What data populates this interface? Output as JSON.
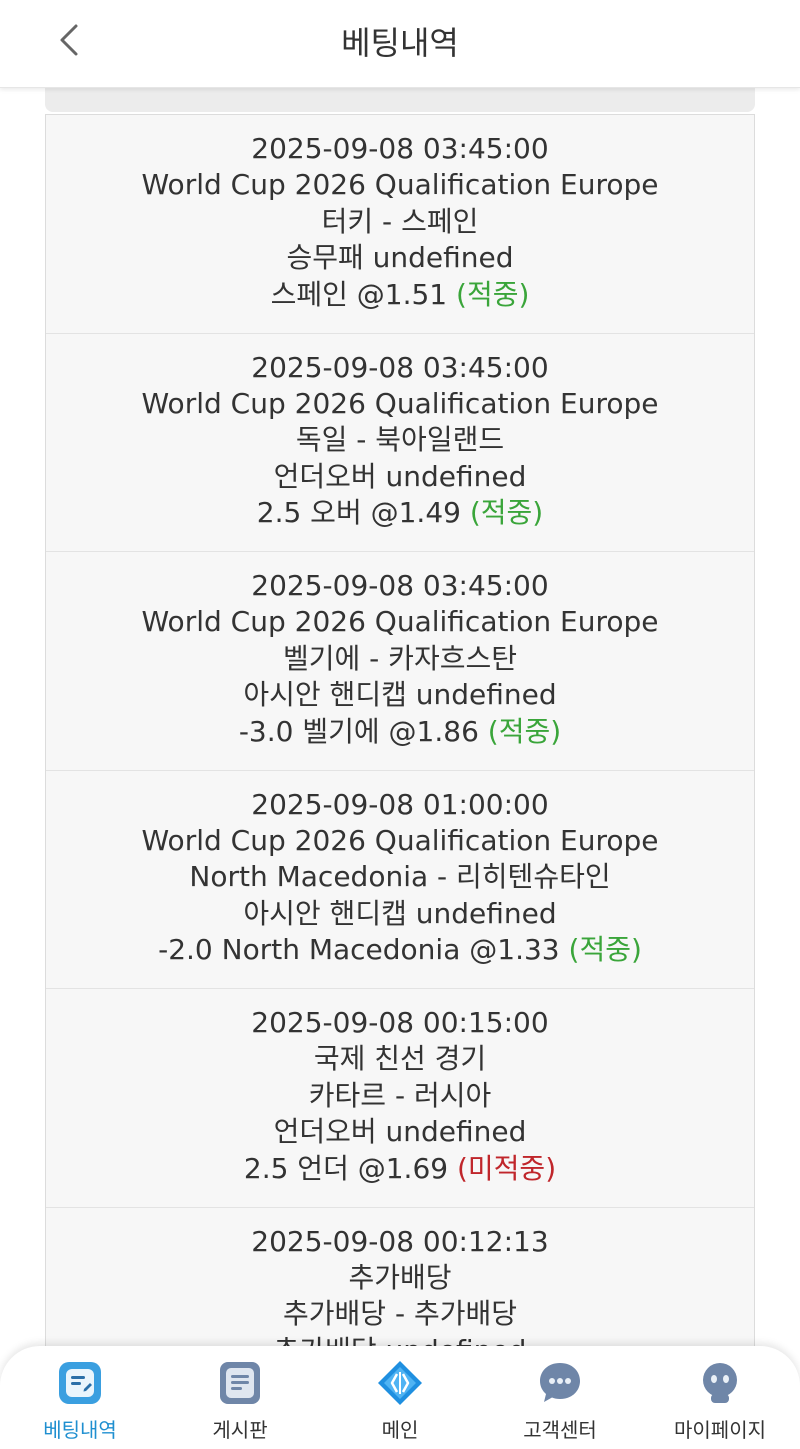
{
  "header": {
    "title": "베팅내역",
    "back_icon": "chevron-left-icon"
  },
  "bets": [
    {
      "datetime": "2025-09-08 03:45:00",
      "league": "World Cup 2026 Qualification Europe",
      "match": "터키 - 스페인",
      "market": "승무패 undefined",
      "pick": "스페인 @1.51",
      "result": "(적중)",
      "result_color": "#3aa53a"
    },
    {
      "datetime": "2025-09-08 03:45:00",
      "league": "World Cup 2026 Qualification Europe",
      "match": "독일 - 북아일랜드",
      "market": "언더오버 undefined",
      "pick": "2.5 오버 @1.49",
      "result": "(적중)",
      "result_color": "#3aa53a"
    },
    {
      "datetime": "2025-09-08 03:45:00",
      "league": "World Cup 2026 Qualification Europe",
      "match": "벨기에 - 카자흐스탄",
      "market": "아시안 핸디캡 undefined",
      "pick": "-3.0 벨기에 @1.86",
      "result": "(적중)",
      "result_color": "#3aa53a"
    },
    {
      "datetime": "2025-09-08 01:00:00",
      "league": "World Cup 2026 Qualification Europe",
      "match": "North Macedonia - 리히텐슈타인",
      "market": "아시안 핸디캡 undefined",
      "pick": "-2.0 North Macedonia @1.33",
      "result": "(적중)",
      "result_color": "#3aa53a"
    },
    {
      "datetime": "2025-09-08 00:15:00",
      "league": "국제 친선 경기",
      "match": "카타르 - 러시아",
      "market": "언더오버 undefined",
      "pick": "2.5 언더 @1.69",
      "result": "(미적중)",
      "result_color": "#c0262b"
    },
    {
      "datetime": "2025-09-08 00:12:13",
      "league": "추가배당",
      "match": "추가배당 - 추가배당",
      "market": "추가배당 undefined",
      "pick": "",
      "result": "",
      "result_color": "#3aa53a"
    }
  ],
  "nav": {
    "items": [
      {
        "label": "베팅내역",
        "icon": "betting-history-icon",
        "active": true
      },
      {
        "label": "게시판",
        "icon": "board-icon",
        "active": false
      },
      {
        "label": "메인",
        "icon": "main-diamond-icon",
        "active": false
      },
      {
        "label": "고객센터",
        "icon": "chat-bubble-icon",
        "active": false
      },
      {
        "label": "마이페이지",
        "icon": "user-icon",
        "active": false
      }
    ]
  },
  "colors": {
    "accent": "#1f8fd0",
    "win": "#3aa53a",
    "lose": "#c0262b"
  }
}
